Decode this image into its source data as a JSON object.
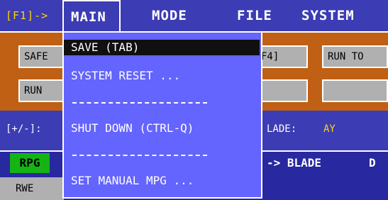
{
  "menubar": {
    "f1_label": "[F1]->",
    "items": [
      "MAIN",
      "MODE",
      "FILE",
      "SYSTEM"
    ]
  },
  "panel": {
    "buttons": [
      {
        "label": "SAFE"
      },
      {
        "label": "RUN"
      },
      {
        "label": "F4]"
      },
      {
        "label": "RUN TO"
      }
    ]
  },
  "status": {
    "left_label": "[+/-]:",
    "blade_label": "LADE:",
    "blade_value": "AY"
  },
  "bottom": {
    "rpg": "RPG",
    "rwe": "RWE",
    "blade": "-> BLADE",
    "d": "D"
  },
  "dropdown": {
    "items": [
      {
        "label": "SAVE (TAB)"
      },
      {
        "label": "SYSTEM RESET ..."
      },
      {
        "label": "SHUT DOWN (CTRL-Q)"
      },
      {
        "label": "SET MANUAL MPG ..."
      }
    ]
  },
  "colors": {
    "menubar_bg": "#3c3cb4",
    "dropdown_bg": "#6464ff",
    "panel": "#c06014",
    "rpg": "#14b414",
    "accent": "#ffd400"
  }
}
